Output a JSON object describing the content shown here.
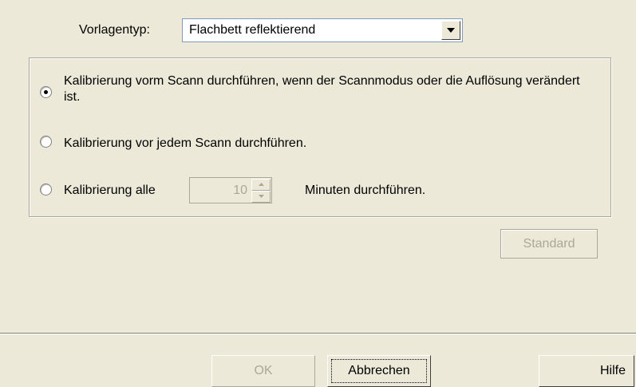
{
  "vorlagentyp": {
    "label": "Vorlagentyp:",
    "selected": "Flachbett reflektierend"
  },
  "calibration": {
    "selected_option": 1,
    "option1": "Kalibrierung vorm Scann durchführen, wenn der Scannmodus oder die Auflösung verändert ist.",
    "option2": "Kalibrierung vor jedem Scann durchführen.",
    "option3_prefix": "Kalibrierung alle",
    "interval_value": "10",
    "option3_suffix": "Minuten durchführen."
  },
  "buttons": {
    "standard": "Standard",
    "ok": "OK",
    "abbrechen": "Abbrechen",
    "hilfe": "Hilfe"
  },
  "icons": {
    "combo_arrow": "chevron-down-icon",
    "spin_up": "spin-up-icon",
    "spin_down": "spin-down-icon"
  }
}
